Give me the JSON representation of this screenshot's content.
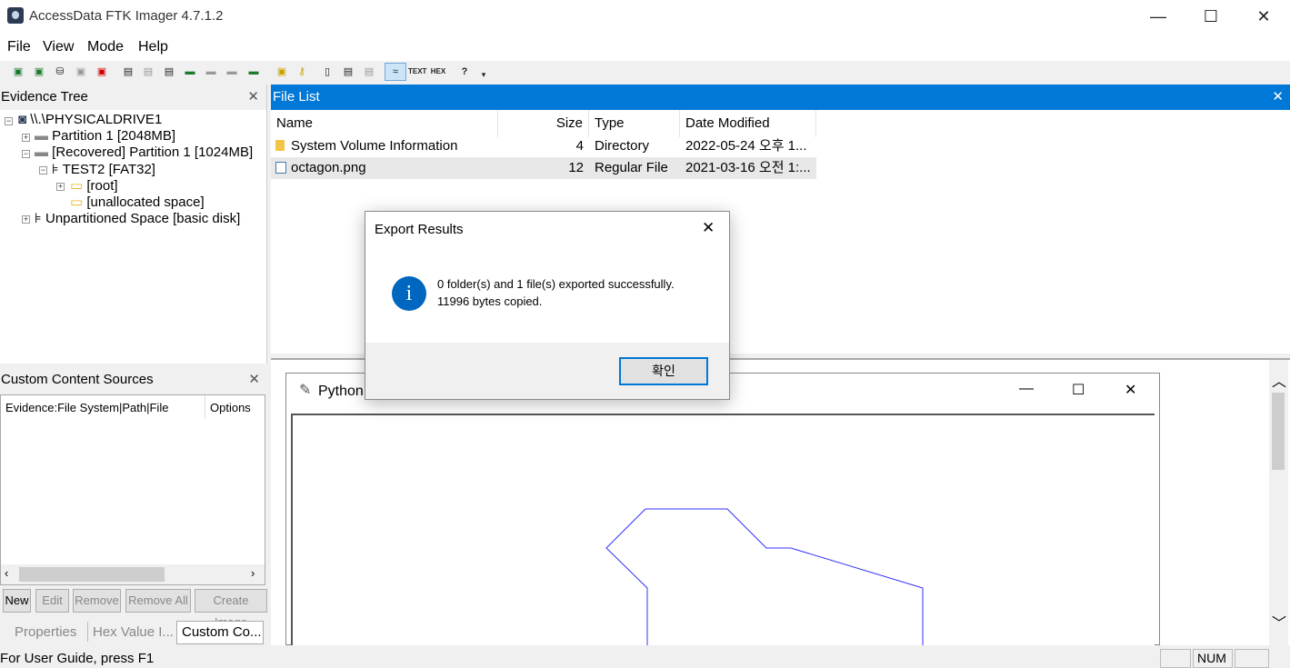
{
  "window": {
    "title": "AccessData FTK Imager 4.7.1.2"
  },
  "menu": [
    "File",
    "View",
    "Mode",
    "Help"
  ],
  "evidence_tree": {
    "title": "Evidence Tree",
    "items": [
      "\\\\.\\PHYSICALDRIVE1",
      "Partition 1 [2048MB]",
      "[Recovered] Partition 1 [1024MB]",
      "TEST2 [FAT32]",
      "[root]",
      "[unallocated space]",
      "Unpartitioned Space [basic disk]"
    ]
  },
  "custom_sources": {
    "title": "Custom Content Sources",
    "columns": [
      "Evidence:File System|Path|File",
      "Options"
    ],
    "buttons": [
      "New",
      "Edit",
      "Remove",
      "Remove All",
      "Create Image"
    ]
  },
  "bottom_tabs": [
    "Properties",
    "Hex Value I...",
    "Custom Co..."
  ],
  "file_list": {
    "title": "File List",
    "columns": [
      "Name",
      "Size",
      "Type",
      "Date Modified"
    ],
    "rows": [
      {
        "name": "System Volume Information",
        "size": "4",
        "type": "Directory",
        "date": "2022-05-24 오후 1..."
      },
      {
        "name": "octagon.png",
        "size": "12",
        "type": "Regular File",
        "date": "2021-03-16 오전 1:..."
      }
    ]
  },
  "viewer": {
    "python_window_title": "Python"
  },
  "dialog": {
    "title": "Export Results",
    "line1": "0 folder(s) and 1 file(s) exported successfully.",
    "line2": "11996 bytes copied.",
    "ok": "확인"
  },
  "status": {
    "text": "For User Guide, press F1",
    "num": "NUM"
  },
  "colors": {
    "accent": "#0078d7",
    "octagon": "#3030ff",
    "info_icon": "#0067c0"
  }
}
